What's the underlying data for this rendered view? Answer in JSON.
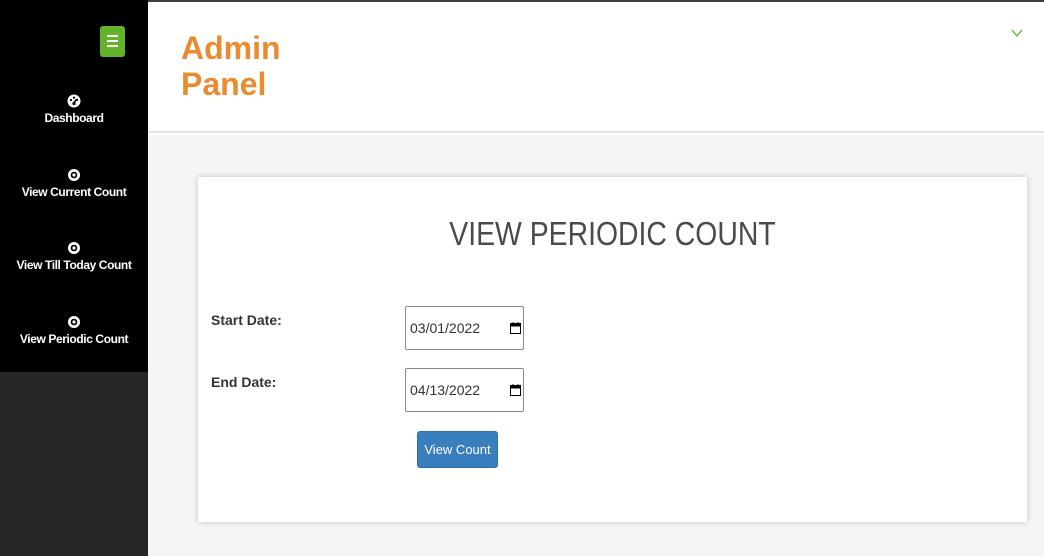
{
  "app": {
    "brand": "Admin Panel"
  },
  "sidebar": {
    "items": [
      {
        "label": "Dashboard",
        "icon": "dashboard-icon"
      },
      {
        "label": "View Current Count",
        "icon": "eye-icon"
      },
      {
        "label": "View Till Today Count",
        "icon": "eye-icon"
      },
      {
        "label": "View Periodic Count",
        "icon": "eye-icon"
      }
    ]
  },
  "main": {
    "title": "VIEW PERIODIC COUNT",
    "start_label": "Start Date:",
    "start_value": "03/01/2022",
    "end_label": "End Date:",
    "end_value": "04/13/2022",
    "submit_label": "View Count"
  },
  "colors": {
    "brand": "#ea8b2f",
    "menu_button": "#63b32b",
    "primary_button": "#3a7fbd",
    "sidebar": "#000000"
  }
}
